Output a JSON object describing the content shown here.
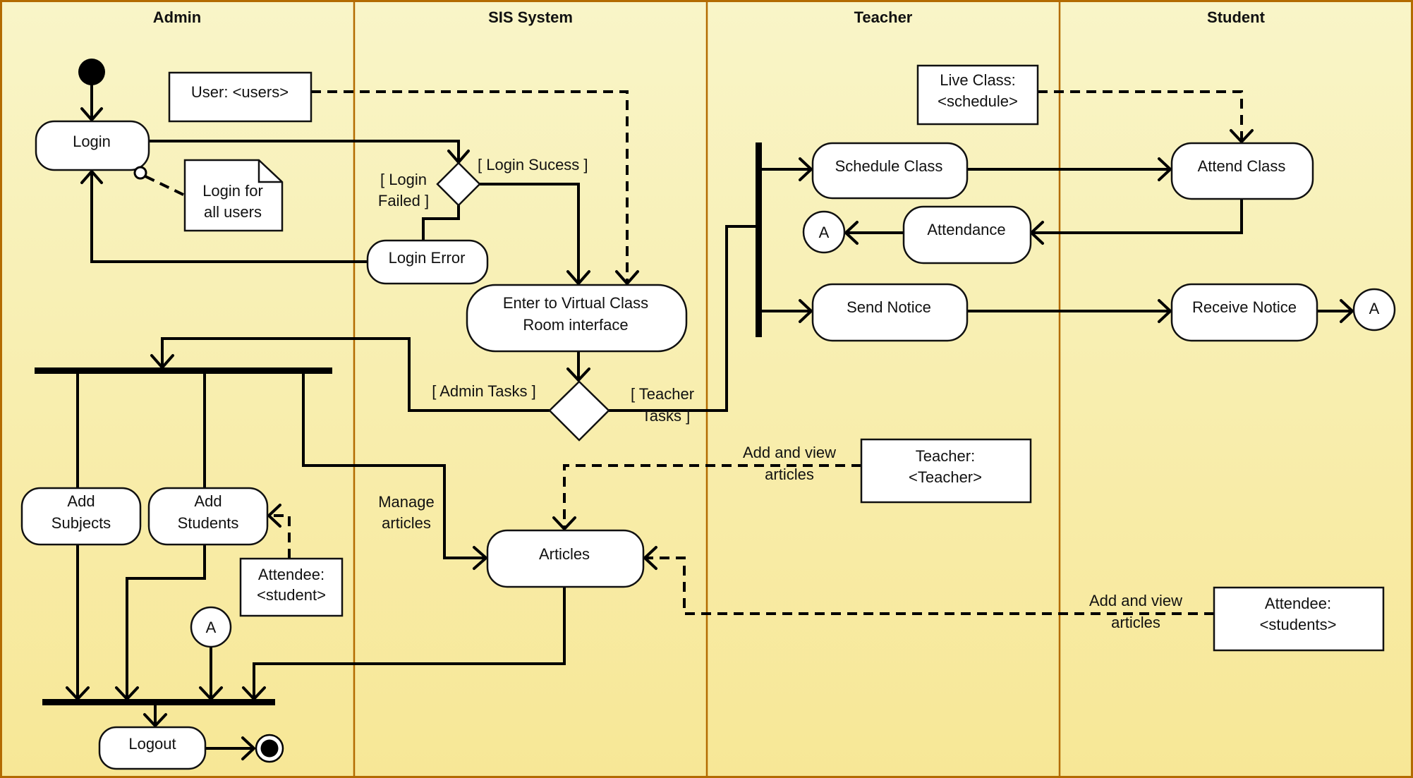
{
  "diagram": {
    "type": "UML activity diagram (swimlanes)",
    "colors": {
      "lane_border": "#b36b00",
      "background_top": "#f9f5c8",
      "background_bottom": "#f7e796",
      "node_fill": "#ffffff",
      "line": "#000000"
    },
    "lanes": [
      {
        "id": "admin",
        "title": "Admin"
      },
      {
        "id": "sis",
        "title": "SIS System"
      },
      {
        "id": "teacher",
        "title": "Teacher"
      },
      {
        "id": "student",
        "title": "Student"
      }
    ],
    "actions": {
      "login": "Login",
      "login_error": "Login Error",
      "enter_vcr_line1": "Enter to Virtual Class",
      "enter_vcr_line2": "Room interface",
      "add_subjects_line1": "Add",
      "add_subjects_line2": "Subjects",
      "add_students_line1": "Add",
      "add_students_line2": "Students",
      "articles": "Articles",
      "logout": "Logout",
      "schedule_class": "Schedule Class",
      "attendance": "Attendance",
      "send_notice": "Send Notice",
      "attend_class": "Attend Class",
      "receive_notice": "Receive Notice"
    },
    "objects": {
      "user": "User: <users>",
      "live_class_line1": "Live Class:",
      "live_class_line2": "<schedule>",
      "attendee_student_line1": "Attendee:",
      "attendee_student_line2": "<student>",
      "teacher_line1": "Teacher:",
      "teacher_line2": "<Teacher>",
      "attendee_students_line1": "Attendee:",
      "attendee_students_line2": "<students>"
    },
    "note": {
      "line1": "Login for",
      "line2": "all users"
    },
    "guards": {
      "login_success": "[ Login Sucess ]",
      "login_failed_line1": "[ Login",
      "login_failed_line2": "Failed ]",
      "admin_tasks": "[ Admin Tasks ]",
      "teacher_tasks_line1": "[ Teacher",
      "teacher_tasks_line2": "Tasks ]"
    },
    "edge_labels": {
      "manage_articles_line1": "Manage",
      "manage_articles_line2": "articles",
      "teacher_add_view_line1": "Add and view",
      "teacher_add_view_line2": "articles",
      "student_add_view_line1": "Add and view",
      "student_add_view_line2": "articles"
    },
    "connectors": {
      "a": "A"
    }
  }
}
